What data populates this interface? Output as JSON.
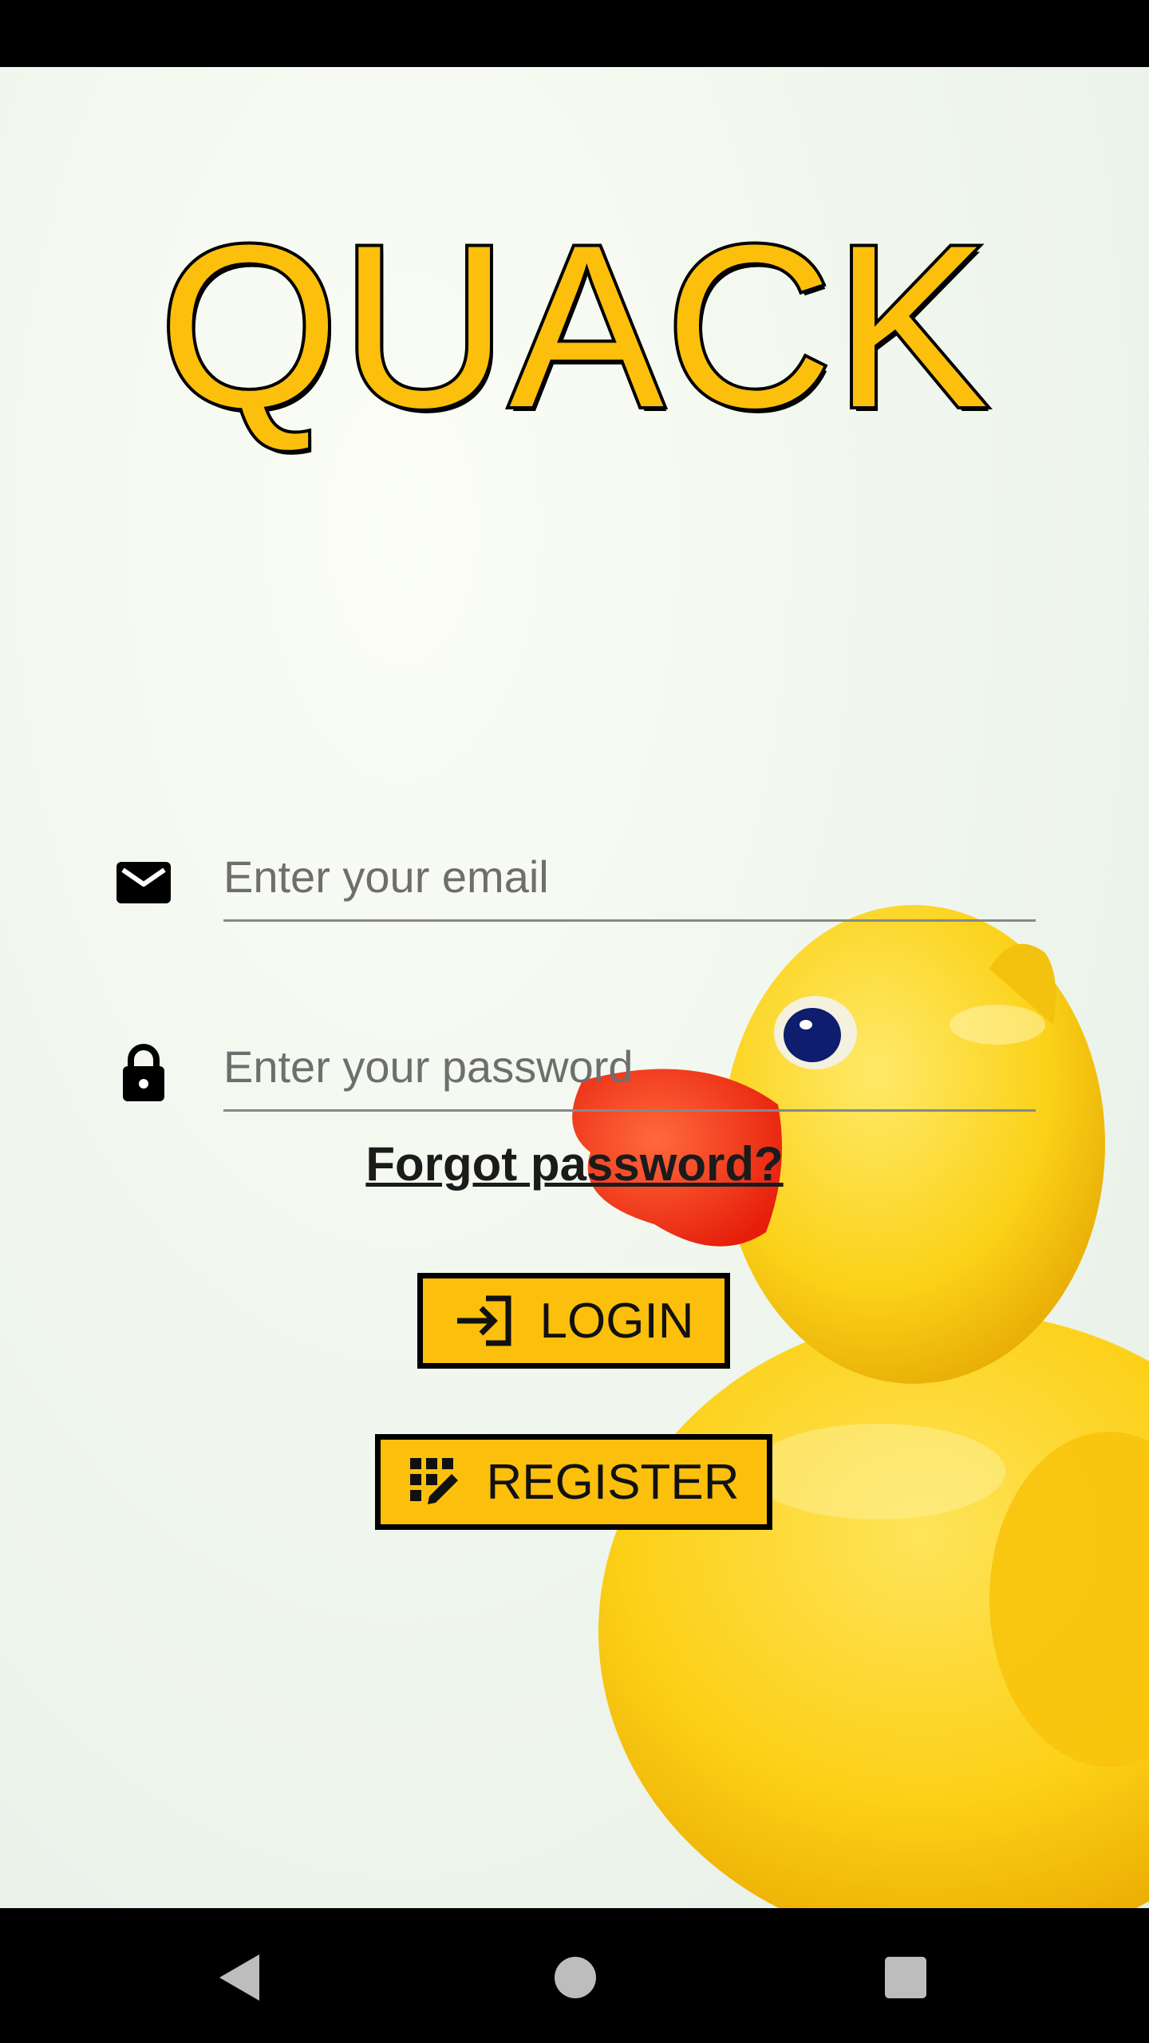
{
  "app": {
    "logo_text": "QUACK"
  },
  "login_form": {
    "email": {
      "icon": "envelope-icon",
      "placeholder": "Enter your email",
      "value": ""
    },
    "password": {
      "icon": "lock-icon",
      "placeholder": "Enter your password",
      "value": ""
    },
    "forgot_password_label": "Forgot password?",
    "login_button": {
      "icon": "login-arrow-icon",
      "label": "LOGIN"
    },
    "register_button": {
      "icon": "register-grid-pencil-icon",
      "label": "REGISTER"
    }
  },
  "system_nav": {
    "back": "back-triangle-icon",
    "home": "home-circle-icon",
    "recents": "recents-square-icon"
  },
  "colors": {
    "accent": "#fcbf0c",
    "outline": "#000000",
    "background": "#f1f7ee"
  }
}
